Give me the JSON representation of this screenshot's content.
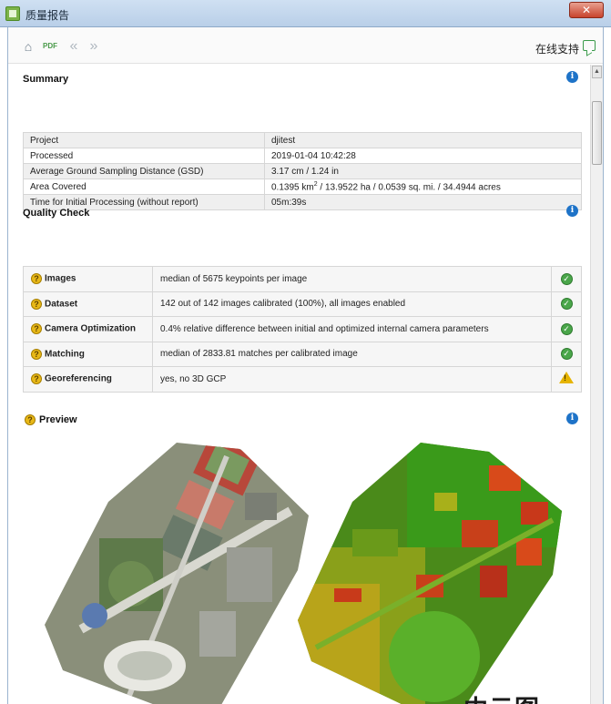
{
  "window": {
    "title": "质量报告"
  },
  "toolbar": {
    "home_icon": "home-icon",
    "pdf_icon": "pdf-icon",
    "back_icon": "back-icon",
    "forward_icon": "forward-icon",
    "support_label": "在线支持",
    "support_icon": "chat-icon"
  },
  "summary": {
    "title": "Summary",
    "rows": [
      {
        "label": "Project",
        "value": "djitest"
      },
      {
        "label": "Processed",
        "value": "2019-01-04 10:42:28"
      },
      {
        "label": "Average Ground Sampling Distance (GSD)",
        "value": "3.17 cm / 1.24 in"
      },
      {
        "label": "Area Covered",
        "value_prefix": "0.1395 km",
        "value_sup": "2",
        "value_suffix": " / 13.9522 ha / 0.0539 sq. mi. / 34.4944 acres"
      },
      {
        "label": "Time for Initial Processing (without report)",
        "value": "05m:39s"
      }
    ]
  },
  "quality": {
    "title": "Quality Check",
    "rows": [
      {
        "name": "Images",
        "detail": "median of 5675 keypoints per image",
        "status": "ok"
      },
      {
        "name": "Dataset",
        "detail": "142 out of 142 images calibrated (100%), all images enabled",
        "status": "ok"
      },
      {
        "name": "Camera Optimization",
        "detail": "0.4% relative difference between initial and optimized internal camera parameters",
        "status": "ok"
      },
      {
        "name": "Matching",
        "detail": "median of 2833.81 matches per calibrated image",
        "status": "ok"
      },
      {
        "name": "Georeferencing",
        "detail": "yes, no 3D GCP",
        "status": "warning"
      }
    ]
  },
  "preview": {
    "title": "Preview"
  },
  "watermark": "中云图",
  "colors": {
    "ok": "#4aa64a",
    "warning": "#e6b400",
    "info": "#1e73c8"
  }
}
